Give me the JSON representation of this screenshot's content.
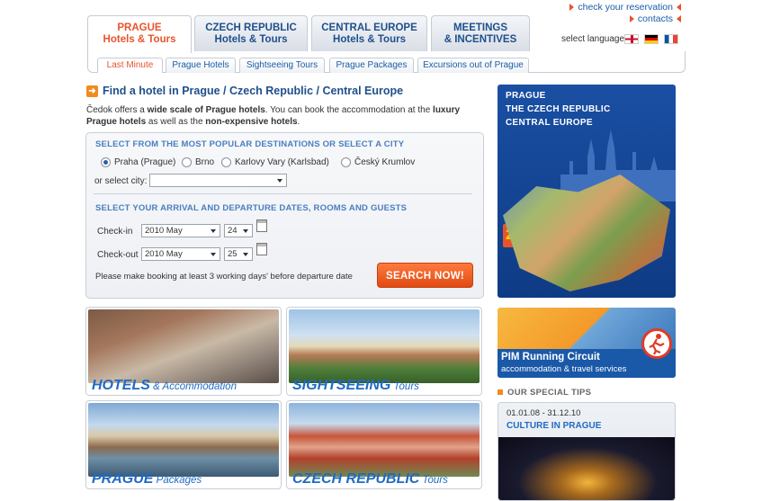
{
  "top_links": {
    "check_reservation": "check your reservation",
    "contacts": "contacts"
  },
  "main_tabs": [
    {
      "line1": "PRAGUE",
      "line2": "Hotels & Tours"
    },
    {
      "line1": "CZECH REPUBLIC",
      "line2": "Hotels & Tours"
    },
    {
      "line1": "CENTRAL EUROPE",
      "line2": "Hotels & Tours"
    },
    {
      "line1": "MEETINGS",
      "line2": "& INCENTIVES"
    }
  ],
  "language": {
    "label": "select language",
    "flags": [
      "uk-flag-icon",
      "german-flag-icon",
      "french-flag-icon"
    ]
  },
  "sub_tabs": [
    "Last Minute",
    "Prague Hotels",
    "Sightseeing Tours",
    "Prague Packages",
    "Excursions out of Prague"
  ],
  "find": {
    "title": "Find a hotel in Prague / Czech Republic / Central Europe",
    "intro_a": "Čedok offers a ",
    "intro_b": "wide scale of Prague hotels",
    "intro_c": ". You can book the accommodation at the ",
    "intro_d": "luxury Prague hotels",
    "intro_e": " as well as the ",
    "intro_f": "non-expensive hotels",
    "intro_g": "."
  },
  "search": {
    "dest_heading": "SELECT FROM THE MOST POPULAR DESTINATIONS OR SELECT A CITY",
    "destinations": [
      "Praha (Prague)",
      "Brno",
      "Karlovy Vary (Karlsbad)",
      "Český Krumlov"
    ],
    "selected_destination": "Praha (Prague)",
    "or_select_city": "or select city:",
    "city_value": "",
    "dates_heading": "SELECT YOUR ARRIVAL AND DEPARTURE DATES, ROOMS AND GUESTS",
    "checkin_label": "Check-in",
    "checkin_month": "2010 May",
    "checkin_day": "24",
    "checkout_label": "Check-out",
    "checkout_month": "2010 May",
    "checkout_day": "25",
    "note": "Please make booking at least 3 working days' before departure date",
    "button": "SEARCH NOW!"
  },
  "tiles": [
    {
      "main": "HOTELS",
      "sub": " & Accommodation"
    },
    {
      "main": "SIGHTSEEING",
      "sub": " Tours"
    },
    {
      "main": "PRAGUE",
      "sub": " Packages"
    },
    {
      "main": "CZECH REPUBLIC",
      "sub": " Tours"
    }
  ],
  "banner": {
    "l1": "PRAGUE",
    "l2": "THE CZECH REPUBLIC",
    "l3": "CENTRAL EUROPE",
    "year": "2010"
  },
  "pim": {
    "title": "PIM Running Circuit",
    "sub": "accommodation & travel services"
  },
  "tips": {
    "heading": "OUR SPECIAL TIPS",
    "date": "01.01.08 - 31.12.10",
    "name": "CULTURE IN PRAGUE"
  }
}
